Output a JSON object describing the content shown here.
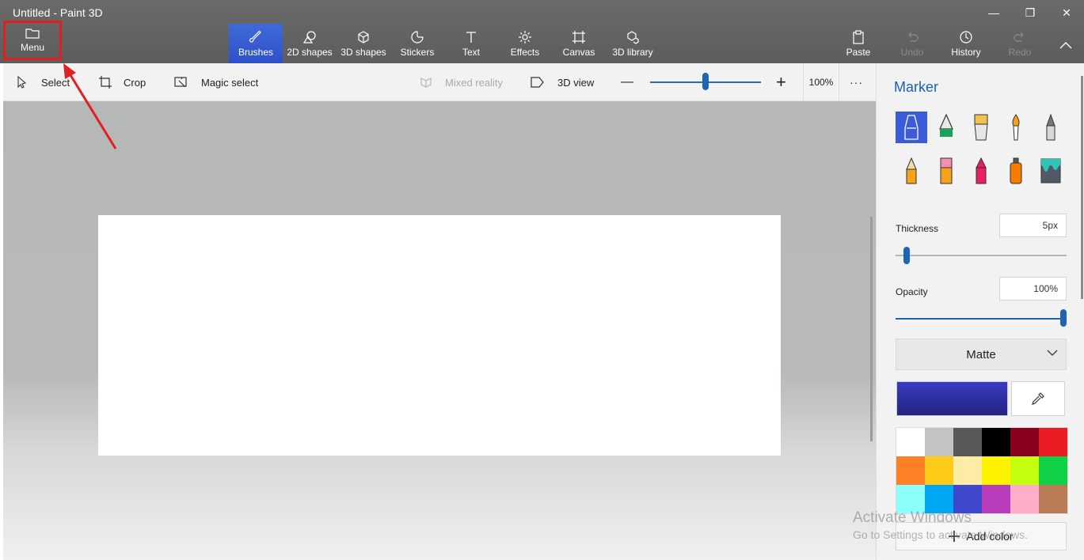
{
  "app": {
    "title": "Untitled - Paint 3D"
  },
  "window_controls": {
    "minimize": "—",
    "restore": "❐",
    "close": "✕"
  },
  "menu": {
    "label": "Menu"
  },
  "ribbon": {
    "tabs": [
      {
        "label": "Brushes",
        "icon": "brush-icon",
        "active": true
      },
      {
        "label": "2D shapes",
        "icon": "2d-shapes-icon"
      },
      {
        "label": "3D shapes",
        "icon": "cube-icon"
      },
      {
        "label": "Stickers",
        "icon": "sticker-icon"
      },
      {
        "label": "Text",
        "icon": "text-icon"
      },
      {
        "label": "Effects",
        "icon": "sun-icon"
      },
      {
        "label": "Canvas",
        "icon": "canvas-icon"
      },
      {
        "label": "3D library",
        "icon": "3d-library-icon"
      }
    ],
    "actions": {
      "paste": "Paste",
      "undo": "Undo",
      "history": "History",
      "redo": "Redo"
    }
  },
  "toolbar": {
    "select": "Select",
    "crop": "Crop",
    "magic_select": "Magic select",
    "mixed_reality": "Mixed reality",
    "view_3d": "3D view",
    "zoom_minus": "—",
    "zoom_plus": "+",
    "zoom_value": "100%",
    "zoom_level": 0.5,
    "more": "···"
  },
  "panel": {
    "title": "Marker",
    "brushes": [
      "marker",
      "calligraphy-pen",
      "oil-brush",
      "watercolor",
      "pixel-pen",
      "pencil",
      "eraser",
      "crayon",
      "spray-can",
      "fill"
    ],
    "thickness_label": "Thickness",
    "thickness_value": "5px",
    "thickness_level": 0.05,
    "opacity_label": "Opacity",
    "opacity_value": "100%",
    "opacity_level": 1.0,
    "finish": "Matte",
    "current_color": "#3a3ac0",
    "palette": [
      "#ffffff",
      "#c3c3c3",
      "#585858",
      "#000000",
      "#88001b",
      "#ec1c24",
      "#ff7f27",
      "#ffca18",
      "#fdeca6",
      "#fff200",
      "#c4ff0e",
      "#0ed145",
      "#8cfffb",
      "#00a8f3",
      "#3f48cc",
      "#b83dba",
      "#ffaec8",
      "#b97a56"
    ],
    "add_color": "Add color"
  },
  "watermark": {
    "line1": "Activate Windows",
    "line2": "Go to Settings to activate Windows."
  },
  "colors": {
    "accent": "#3f6ad8",
    "annotation": "#e02020"
  }
}
